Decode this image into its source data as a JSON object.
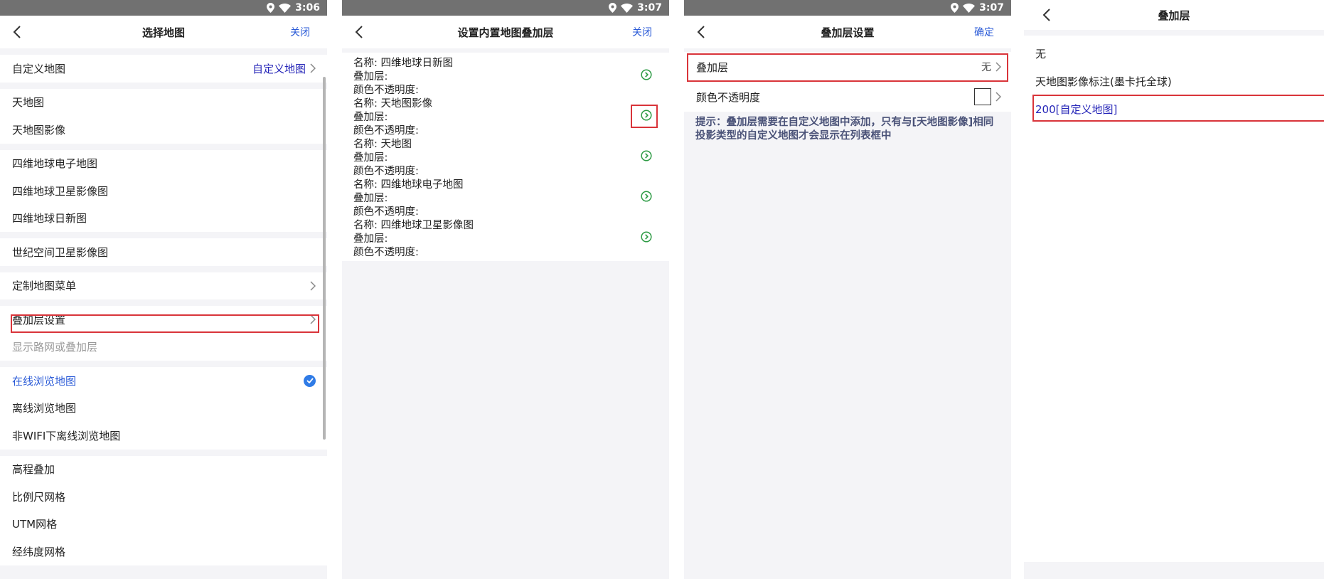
{
  "panel1": {
    "status_time": "3:06",
    "title": "选择地图",
    "action": "关闭",
    "custom_map": {
      "label": "自定义地图",
      "value": "自定义地图"
    },
    "group_tianditu": [
      "天地图",
      "天地图影像"
    ],
    "group_siwei": [
      "四维地球电子地图",
      "四维地球卫星影像图",
      "四维地球日新图"
    ],
    "group_shiji": [
      "世纪空间卫星影像图"
    ],
    "custom_menu": "定制地图菜单",
    "overlay_settings": "叠加层设置",
    "overlay_hint": "显示路网或叠加层",
    "browse_modes": [
      "在线浏览地图",
      "离线浏览地图",
      "非WIFI下离线浏览地图"
    ],
    "tools": [
      "高程叠加",
      "比例尺网格",
      "UTM网格",
      "经纬度网格"
    ]
  },
  "panel2": {
    "status_time": "3:07",
    "title": "设置内置地图叠加层",
    "action": "关闭",
    "layers": [
      {
        "name": "名称: 四维地球日新图",
        "overlay": "叠加层:",
        "opacity": "颜色不透明度:"
      },
      {
        "name": "名称: 天地图影像",
        "overlay": "叠加层:",
        "opacity": "颜色不透明度:"
      },
      {
        "name": "名称: 天地图",
        "overlay": "叠加层:",
        "opacity": "颜色不透明度:"
      },
      {
        "name": "名称: 四维地球电子地图",
        "overlay": "叠加层:",
        "opacity": "颜色不透明度:"
      },
      {
        "name": "名称: 四维地球卫星影像图",
        "overlay": "叠加层:",
        "opacity": "颜色不透明度:"
      }
    ]
  },
  "panel3": {
    "status_time": "3:07",
    "title": "叠加层设置",
    "action": "确定",
    "overlay_label": "叠加层",
    "overlay_value": "无",
    "opacity_label": "颜色不透明度",
    "hint": "提示：叠加层需要在自定义地图中添加，只有与[天地图影像]相同投影类型的自定义地图才会显示在列表框中"
  },
  "panel4": {
    "title": "叠加层",
    "options": [
      "无",
      "天地图影像标注(墨卡托全球)",
      "200[自定义地图]"
    ]
  },
  "colors": {
    "status_bar": "#717171",
    "link_blue": "#2b5bd7",
    "highlight_red": "#d9343a",
    "selected_blue": "#2525b8"
  }
}
